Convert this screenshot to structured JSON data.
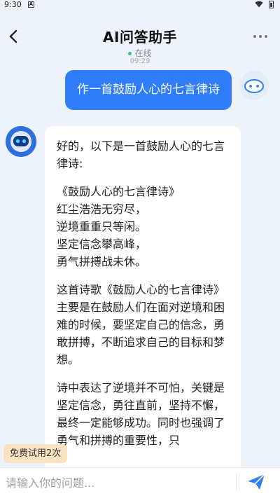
{
  "status_bar": {
    "time": "9:30",
    "notification_icon": "A"
  },
  "header": {
    "title": "AI问答助手",
    "status": "在线",
    "timestamp": "09:29"
  },
  "messages": {
    "user": {
      "text": "作一首鼓励人心的七言律诗"
    },
    "bot": {
      "intro": "好的，以下是一首鼓励人心的七言律诗:",
      "poem_title": "《鼓励人心的七言律诗》",
      "poem_lines": [
        "红尘浩浩无穷尽，",
        "逆境重重只等闲。",
        "坚定信念攀高峰，",
        "勇气拼搏战未休。"
      ],
      "paragraph1": "这首诗歌《鼓励人心的七言律诗》主要是在鼓励人们在面对逆境和困难的时候，要坚定自己的信念，勇敢拼搏，不断追求自己的目标和梦想。",
      "paragraph2": "诗中表达了逆境并不可怕，关键是坚定信念，勇往直前，坚持不懈，最终一定能够成功。同时也强调了勇气和拼搏的重要性，只"
    }
  },
  "trial_badge": "免费试用2次",
  "input": {
    "placeholder": "请输入你的问题...",
    "value": ""
  },
  "colors": {
    "accent": "#2f7dfa",
    "badge_bg": "#fbe3c2",
    "online": "#3cc36b"
  },
  "icons": {
    "back": "chevron-left-icon",
    "more": "more-dots-icon",
    "send": "paper-plane-icon"
  }
}
